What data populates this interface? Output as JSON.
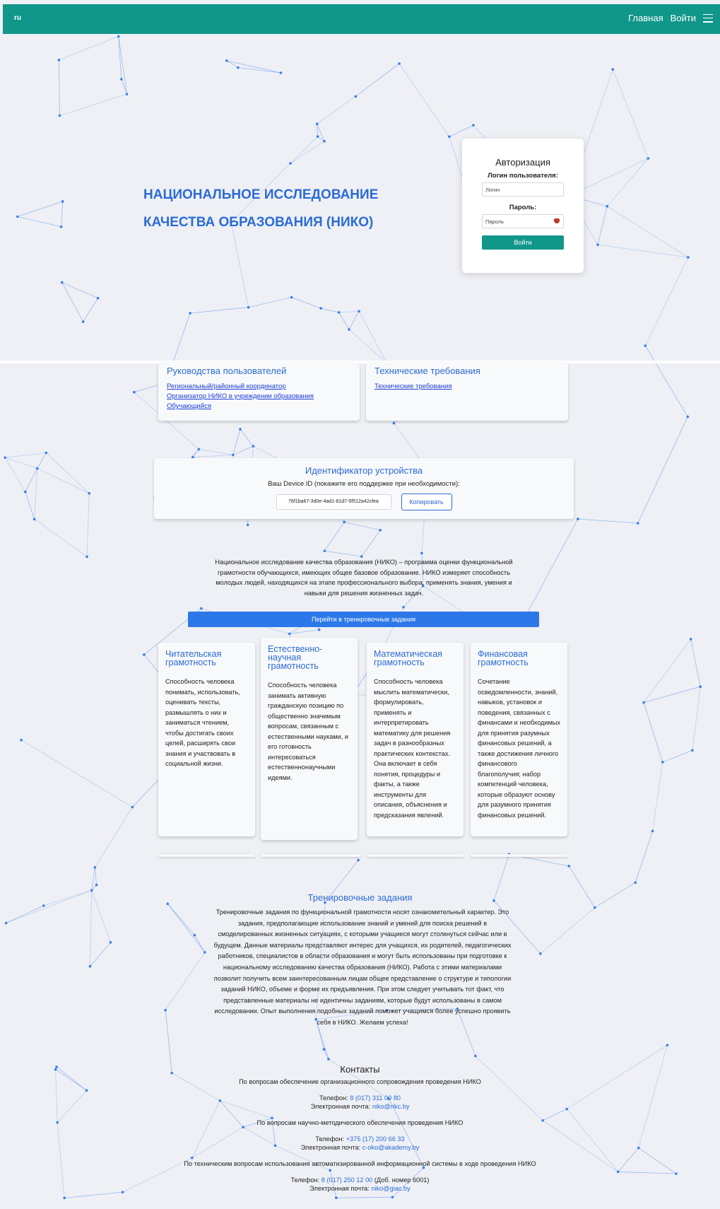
{
  "header": {
    "lang": "ru",
    "nav_home": "Главная",
    "nav_login": "Войти"
  },
  "hero": {
    "title": "НАЦИОНАЛЬНОЕ ИССЛЕДОВАНИЕ КАЧЕСТВА ОБРАЗОВАНИЯ (НИКО)"
  },
  "auth": {
    "title": "Авторизация",
    "login_label": "Логин пользователя:",
    "login_placeholder": "Логин",
    "password_label": "Пароль:",
    "password_placeholder": "Пароль",
    "submit": "Войти"
  },
  "guides": {
    "title": "Руководства пользователей",
    "links": [
      "Региональный/районный координатор",
      "Организатор НИКО в учреждении образования",
      "Обучающийся"
    ]
  },
  "tech": {
    "title": "Технические требования",
    "link": "Технические требования"
  },
  "device": {
    "title": "Идентификатор устройства",
    "subtitle": "Ваш Device ID (покажите его поддержке при необходимости):",
    "id": "76f1ba67-3d0e-4ad1-81d7-5f512a42cfea",
    "copy": "Копировать"
  },
  "intro": "Национальное исследование качества образования (НИКО) – программа оценки функциональной грамотности обучающихся, имеющих общее базовое образование. НИКО измеряет способность молодых людей, находящихся на этапе профессионального выбора, применять знания, умения и навыки для решения жизненных задач.",
  "train_button": "Перейти в тренировочные задания",
  "skills": [
    {
      "title": "Читательская грамотность",
      "text": "Способность человека понимать, использовать, оценивать тексты, размышлять о них и заниматься чтением, чтобы достигать своих целей, расширять свои знания и участвовать в социальной жизни."
    },
    {
      "title": "Естественно-научная грамотность",
      "text": "Способность человека занимать активную гражданскую позицию по общественно значимым вопросам, связанным с естественными науками, и его готовность интересоваться естественнонаучными идеями."
    },
    {
      "title": "Математическая грамотность",
      "text": "Способность человека мыслить математически, формулировать, применять и интерпретировать математику для решения задач в разнообразных практических контекстах. Она включает в себя понятия, процедуры и факты, а также инструменты для описания, объяснения и предсказания явлений."
    },
    {
      "title": "Финансовая грамотность",
      "text": "Сочетание осведомленности, знаний, навыков, установок и поведения, связанных с финансами и необходимых для принятия разумных финансовых решений, а также достижения личного финансового благополучия; набор компетенций человека, которые образуют основу для разумного принятия финансовых решений."
    }
  ],
  "training": {
    "title": "Тренировочные задания",
    "text": "Тренировочные задания по функциональной грамотности носят ознакомительный характер. Это задания, предполагающие использование знаний и умений для поиска решений в смоделированных жизненных ситуациях, с которыми учащиеся могут столкнуться сейчас или в будущем. Данные материалы представляют интерес для учащихся, их родителей, педагогических работников, специалистов в области образования и могут быть использованы при подготовке к национальному исследованию качества образования (НИКО). Работа с этими материалами позволит получить всем заинтересованным лицам общее представление о структуре и типологии заданий НИКО, объеме и форме их предъявления. При этом следует учитывать тот факт, что представленные материалы не идентичны заданиям, которые будут использованы в самом исследовании. Опыт выполнения подобных заданий поможет учащимся более успешно проявить себя в НИКО. Желаем успеха!"
  },
  "contacts": {
    "title": "Контакты",
    "phone_label": "Телефон:",
    "email_label": "Электронная почта:",
    "groups": [
      {
        "question": "По вопросам обеспечение организационного сопровождения проведения НИКО",
        "phone": "8 (017) 311 00 80",
        "phone_extra": "",
        "email": "niko@rikc.by"
      },
      {
        "question": "По вопросам научно-методического обеспечения проведения НИКО",
        "phone": "+375 (17) 200 66 33",
        "phone_extra": "",
        "email": "c-oko@akademy.by"
      },
      {
        "question": "По техническим вопросам использования автоматизированной информационной системы в ходе проведения НИКО",
        "phone": "8 (017) 250 12 00",
        "phone_extra": " (Доб. номер 6001)",
        "email": "niko@giac.by"
      }
    ]
  },
  "colors": {
    "header": "#10978a",
    "accent": "#2b6bd6",
    "train_button": "#2d78e8",
    "background": "#eef0f5"
  }
}
